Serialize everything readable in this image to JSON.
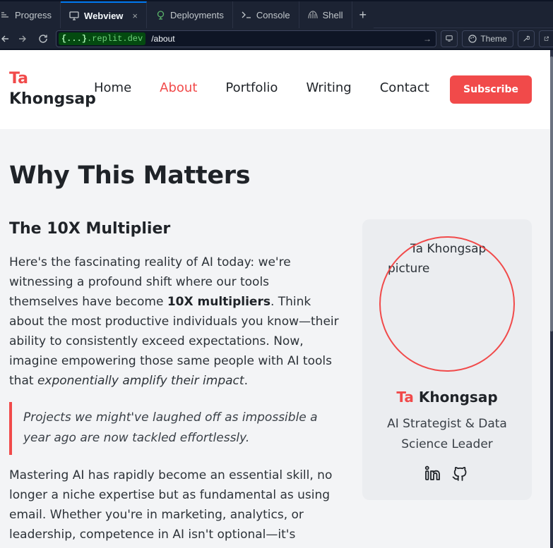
{
  "ide": {
    "tabs": [
      {
        "label": "Progress",
        "icon": "progress-icon"
      },
      {
        "label": "Webview",
        "icon": "monitor-icon",
        "active": true,
        "close": "×"
      },
      {
        "label": "Deployments",
        "icon": "deploy-icon"
      },
      {
        "label": "Console",
        "icon": "terminal-icon"
      },
      {
        "label": "Shell",
        "icon": "shell-icon"
      }
    ],
    "new_tab": "+",
    "url": {
      "domain_prefix": "{...}",
      "domain_suffix": ".replit.dev",
      "path": "/about"
    },
    "theme_label": "Theme"
  },
  "site": {
    "logo_first": "Ta",
    "logo_last": "Khongsap",
    "nav": [
      "Home",
      "About",
      "Portfolio",
      "Writing",
      "Contact"
    ],
    "active_nav": "About",
    "subscribe_label": "Subscribe",
    "heading": "Why This Matters",
    "subheading": "The 10X Multiplier",
    "p1_a": "Here's the fascinating reality of AI today: we're witnessing a profound shift where our tools themselves have become ",
    "p1_bold": "10X multipliers",
    "p1_b": ". Think about the most productive individuals you know—their ability to consistently exceed expectations. Now, imagine empowering those same people with AI tools that ",
    "p1_italic": "exponentially amplify their impact",
    "p1_c": ".",
    "quote": "Projects we might've laughed off as impossible a year ago are now tackled effortlessly.",
    "p2": "Mastering AI has rapidly become an essential skill, no longer a niche expertise but as fundamental as using email. Whether you're in marketing, analytics, or leadership, competence in AI isn't optional—it's",
    "card": {
      "image_alt": "Ta Khongsap picture",
      "name_first": "Ta",
      "name_last": "Khongsap",
      "role": "AI Strategist & Data Science Leader"
    },
    "accent_color": "#f14a4a"
  }
}
